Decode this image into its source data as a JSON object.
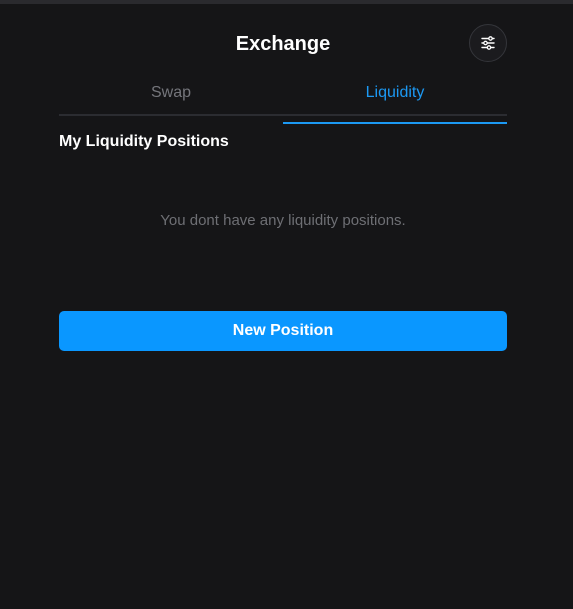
{
  "header": {
    "title": "Exchange",
    "settings_icon": "sliders-icon"
  },
  "tabs": [
    {
      "label": "Swap",
      "active": false
    },
    {
      "label": "Liquidity",
      "active": true
    }
  ],
  "liquidity": {
    "section_title": "My Liquidity Positions",
    "empty_message": "You dont have any liquidity positions.",
    "new_position_label": "New Position"
  },
  "colors": {
    "background": "#151517",
    "accent": "#1c99f3",
    "button": "#0a97ff",
    "muted_text": "#6e6f74"
  }
}
